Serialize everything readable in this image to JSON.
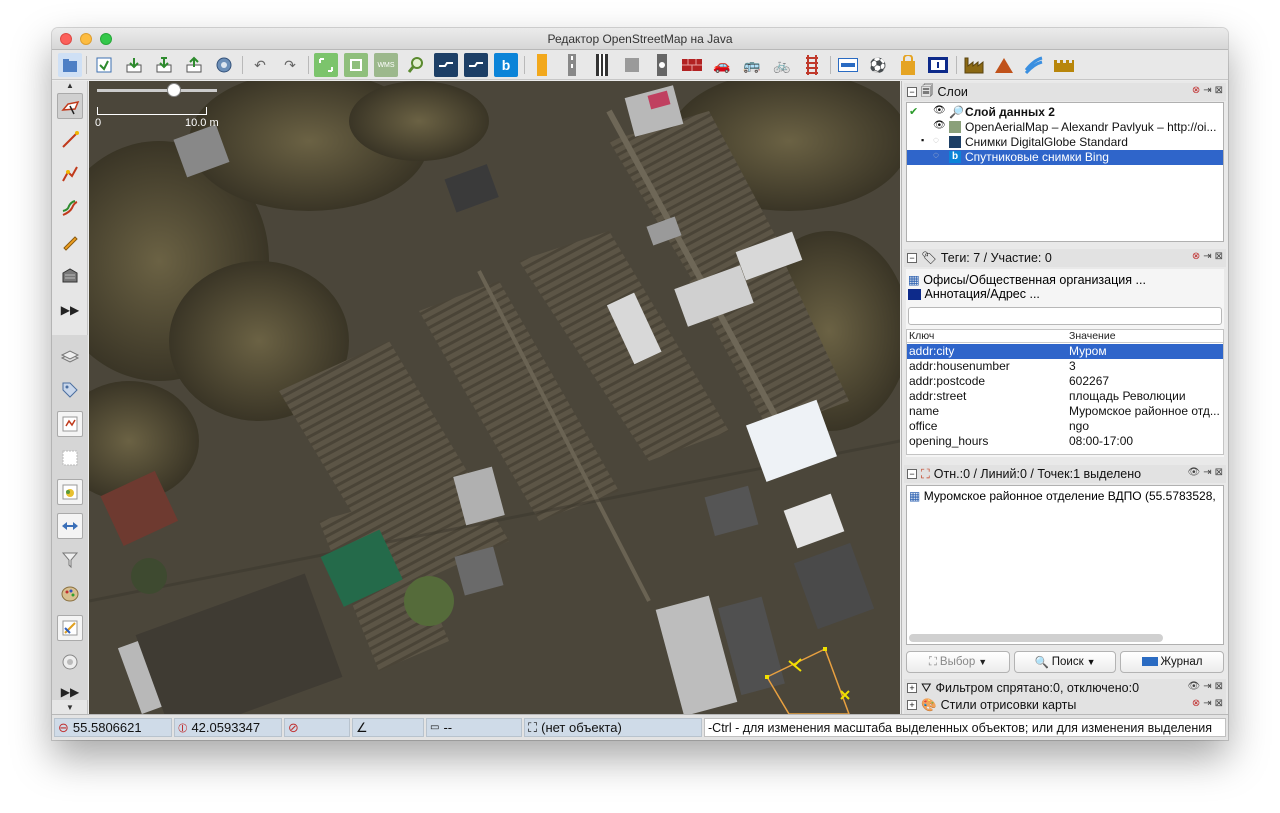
{
  "window": {
    "title": "Редактор OpenStreetMap на Java"
  },
  "toolbar": {
    "icons": [
      "open-file",
      "save",
      "save-as",
      "upload-all",
      "upload",
      "preferences",
      "undo",
      "redo",
      "zoom-to-data",
      "zoom-to-selection",
      "wms",
      "zoom-search",
      "digitalglobe",
      "digitalglobe-standard",
      "bing",
      "road",
      "road2",
      "railway",
      "building",
      "crossing",
      "wall",
      "car",
      "bus",
      "bicycle",
      "rails",
      "hotel",
      "sport",
      "shop",
      "info",
      "industrial",
      "mountain",
      "water",
      "castle"
    ]
  },
  "left_tools": {
    "icons": [
      "select-tool",
      "draw-line-tool",
      "improve-way-tool",
      "parallel-tool",
      "pencil-tool",
      "building-tool",
      "more-tools",
      "layers-toggle",
      "tags-toggle",
      "selection-list-toggle",
      "relation-list-toggle",
      "conflict-toggle",
      "validator-toggle",
      "filter-toggle",
      "map-paint-toggle",
      "author-toggle",
      "changeset-toggle",
      "more-toggles"
    ]
  },
  "map": {
    "scale_start": "0",
    "scale_end": "10.0 m"
  },
  "layers_panel": {
    "title": "Слои",
    "items": [
      {
        "label": "Слой данных 2",
        "bold": true
      },
      {
        "label": "OpenAerialMap – Alexandr Pavlyuk – http://oi..."
      },
      {
        "label": "Снимки DigitalGlobe Standard"
      },
      {
        "label": "Спутниковые снимки Bing",
        "selected": true
      }
    ]
  },
  "tags_panel": {
    "title": "Теги: 7 / Участие: 0",
    "presets": [
      "Офисы/Общественная организация ...",
      "Аннотация/Адрес ..."
    ],
    "col_key": "Ключ",
    "col_value": "Значение",
    "rows": [
      {
        "key": "addr:city",
        "value": "Муром"
      },
      {
        "key": "addr:housenumber",
        "value": "3"
      },
      {
        "key": "addr:postcode",
        "value": "602267"
      },
      {
        "key": "addr:street",
        "value": "площадь Революции"
      },
      {
        "key": "name",
        "value": "Муромское районное отд..."
      },
      {
        "key": "office",
        "value": "ngo"
      },
      {
        "key": "opening_hours",
        "value": "08:00-17:00"
      }
    ]
  },
  "selection_panel": {
    "title": "Отн.:0 / Линий:0 / Точек:1 выделено",
    "item": "Муромское районное отделение ВДПО (55.5783528,"
  },
  "buttons": {
    "select": "Выбор",
    "search": "Поиск",
    "journal": "Журнал"
  },
  "filter_panel": {
    "title": "Фильтром спрятано:0, отключено:0"
  },
  "styles_panel": {
    "title": "Стили отрисовки карты"
  },
  "statusbar": {
    "lat": "55.5806621",
    "lon": "42.0593347",
    "heading": "",
    "angle": "",
    "distance": "--",
    "object": "(нет объекта)",
    "message": "-Ctrl - для изменения масштаба выделенных объектов; или для изменения выделения"
  },
  "colors": {
    "selection": "#2f65ca",
    "status_cell": "#cfdbe8"
  }
}
